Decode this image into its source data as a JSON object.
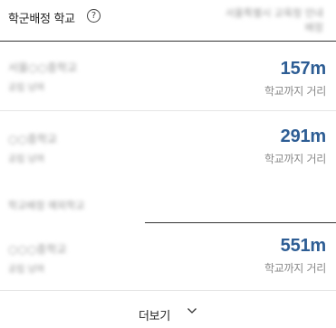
{
  "header": {
    "title": "학군배정 학교",
    "help_icon": "?",
    "blurred_line1": "서울특별시 교육청 안내",
    "blurred_line2": "배정"
  },
  "schools": [
    {
      "name": "서울○○중학교",
      "sub": "공립 남여",
      "distance": "157m",
      "distance_label": "학교까지 거리"
    },
    {
      "name": "○○중학교",
      "sub": "공립 남여",
      "distance": "291m",
      "distance_label": "학교까지 거리"
    },
    {
      "name": "○○○중학교",
      "sub": "공립 남여",
      "distance": "551m",
      "distance_label": "학교까지 거리"
    }
  ],
  "section_label": "학교배정 예외학교",
  "more": {
    "label": "더보기",
    "icon": "chevron-down-icon"
  }
}
